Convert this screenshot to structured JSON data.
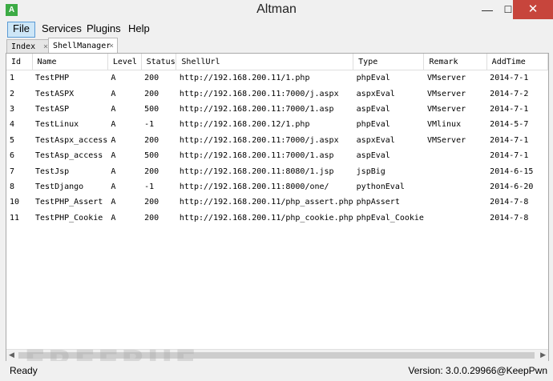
{
  "window": {
    "title": "Altman",
    "icon_letter": "A",
    "minimize_glyph": "—",
    "maximize_glyph": "☐",
    "close_glyph": "✕"
  },
  "menu": [
    "File",
    "Services",
    "Plugins",
    "Help"
  ],
  "tabs": [
    {
      "label": "Index",
      "close": "×"
    },
    {
      "label": "ShellManager",
      "close": "×"
    }
  ],
  "table": {
    "headers": [
      "Id",
      "Name",
      "Level",
      "Status",
      "ShellUrl",
      "Type",
      "Remark",
      "AddTime"
    ],
    "rows": [
      [
        "1",
        "TestPHP",
        "A",
        "200",
        "http://192.168.200.11/1.php",
        "phpEval",
        "VMserver",
        "2014-7-1"
      ],
      [
        "2",
        "TestASPX",
        "A",
        "200",
        "http://192.168.200.11:7000/j.aspx",
        "aspxEval",
        "VMserver",
        "2014-7-2"
      ],
      [
        "3",
        "TestASP",
        "A",
        "500",
        "http://192.168.200.11:7000/1.asp",
        "aspEval",
        "VMserver",
        "2014-7-1"
      ],
      [
        "4",
        "TestLinux",
        "A",
        "-1",
        "http://192.168.200.12/1.php",
        "phpEval",
        "VMlinux",
        "2014-5-7"
      ],
      [
        "5",
        "TestAspx_access",
        "A",
        "200",
        "http://192.168.200.11:7000/j.aspx",
        "aspxEval",
        "VMServer",
        "2014-7-1"
      ],
      [
        "6",
        "TestAsp_access",
        "A",
        "500",
        "http://192.168.200.11:7000/1.asp",
        "aspEval",
        "",
        "2014-7-1"
      ],
      [
        "7",
        "TestJsp",
        "A",
        "200",
        "http://192.168.200.11:8080/1.jsp",
        "jspBig",
        "",
        "2014-6-15"
      ],
      [
        "8",
        "TestDjango",
        "A",
        "-1",
        "http://192.168.200.11:8000/one/",
        "pythonEval",
        "",
        "2014-6-20"
      ],
      [
        "10",
        "TestPHP_Assert",
        "A",
        "200",
        "http://192.168.200.11/php_assert.php",
        "phpAssert",
        "",
        "2014-7-8"
      ],
      [
        "11",
        "TestPHP_Cookie",
        "A",
        "200",
        "http://192.168.200.11/php_cookie.php",
        "phpEval_Cookie",
        "",
        "2014-7-8"
      ]
    ]
  },
  "scrollbar": {
    "left_arrow": "◀",
    "right_arrow": "▶"
  },
  "status": {
    "left": "Ready",
    "right": "Version: 3.0.0.29966@KeepPwn"
  },
  "watermark": "FREEBUF",
  "colors": {
    "close_button": "#c7453c",
    "menu_active": "#cde6f7",
    "app_icon": "#3cab45"
  }
}
